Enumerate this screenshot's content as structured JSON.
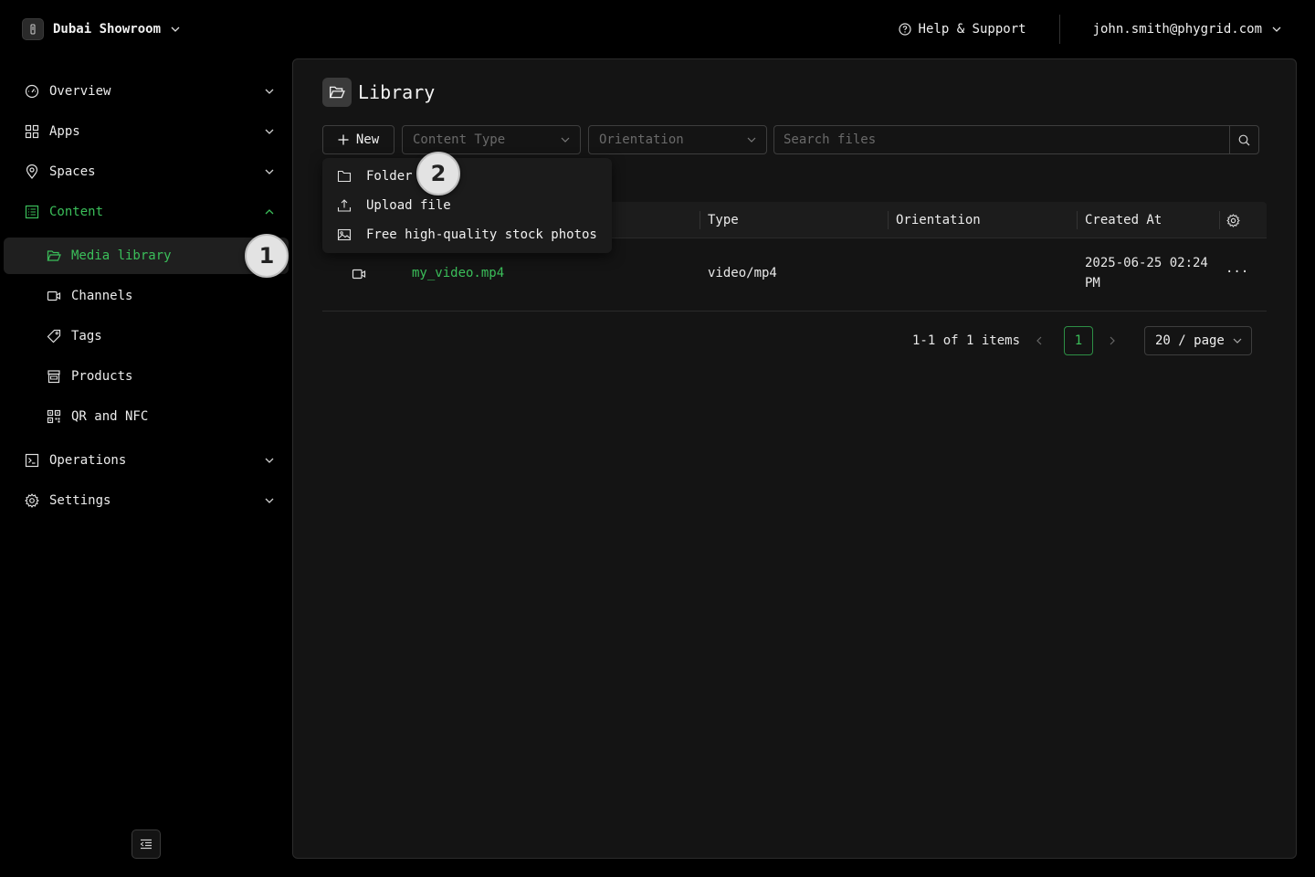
{
  "org": {
    "name": "Dubai Showroom"
  },
  "header": {
    "help_label": "Help & Support",
    "user_email": "john.smith@phygrid.com"
  },
  "sidebar": {
    "items": [
      {
        "label": "Overview",
        "icon": "gauge-icon"
      },
      {
        "label": "Apps",
        "icon": "grid-icon"
      },
      {
        "label": "Spaces",
        "icon": "location-pin-icon"
      },
      {
        "label": "Content",
        "icon": "content-icon"
      },
      {
        "label": "Operations",
        "icon": "terminal-icon"
      },
      {
        "label": "Settings",
        "icon": "gear-icon"
      }
    ],
    "content_children": [
      {
        "label": "Media library",
        "icon": "folder-open-icon"
      },
      {
        "label": "Channels",
        "icon": "video-camera-icon"
      },
      {
        "label": "Tags",
        "icon": "tag-icon"
      },
      {
        "label": "Products",
        "icon": "store-icon"
      },
      {
        "label": "QR and NFC",
        "icon": "qr-code-icon"
      }
    ]
  },
  "annotations": {
    "badge1": "1",
    "badge2": "2"
  },
  "main": {
    "title": "Library",
    "toolbar": {
      "new_label": "New",
      "content_type_placeholder": "Content Type",
      "orientation_placeholder": "Orientation",
      "search_placeholder": "Search files"
    },
    "new_menu": [
      {
        "label": "Folder",
        "icon": "folder-icon"
      },
      {
        "label": "Upload file",
        "icon": "upload-icon"
      },
      {
        "label": "Free high-quality stock photos",
        "icon": "image-icon"
      }
    ],
    "table": {
      "columns": [
        "Type",
        "Orientation",
        "Created At"
      ],
      "rows": [
        {
          "name": "my_video.mp4",
          "type": "video/mp4",
          "orientation": "",
          "created_at_line1": "2025-06-25 02:24",
          "created_at_line2": "PM",
          "actions": "···"
        }
      ]
    },
    "pagination": {
      "summary": "1-1 of 1 items",
      "current_page": "1",
      "page_size": "20 / page"
    }
  },
  "colors": {
    "accent": "#3bbf5a",
    "background": "#000000",
    "panel": "#141414"
  }
}
